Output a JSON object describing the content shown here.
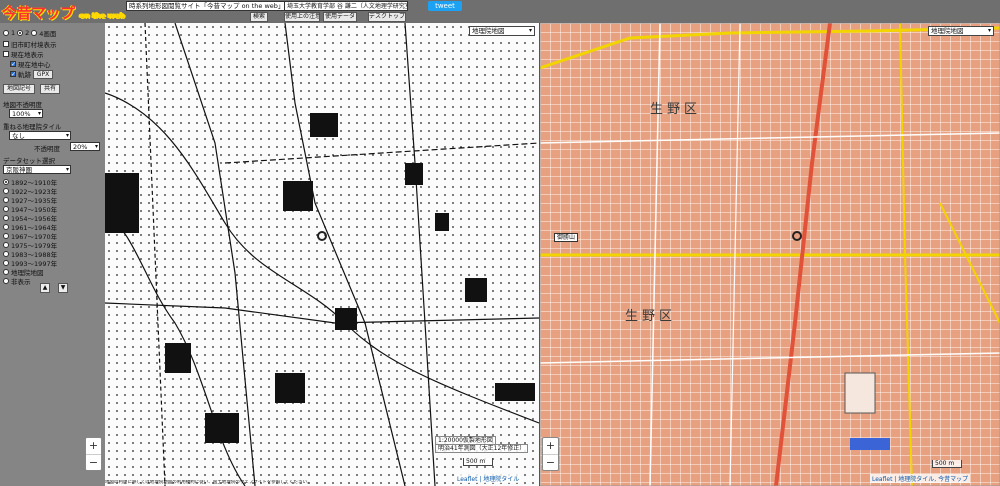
{
  "header": {
    "logo_main": "今昔マップ",
    "logo_sub": "on the web",
    "site_title": "時系列地形図閲覧サイト「今昔マップ on the web」",
    "author": "埼玉大学教育学部 谷 謙二（人文地理学研究室）",
    "buttons": {
      "help": "使用上の注意",
      "data": "使用データ",
      "desktop": "デスクトップ版",
      "how": "操作"
    },
    "tweet": "tweet",
    "search_label": "検索"
  },
  "sidebar": {
    "panes": [
      "1",
      "2",
      "4画面"
    ],
    "show_boundary": "旧市町村境表示",
    "show_location": "現在地表示",
    "current_center": "現在地中心",
    "track": "軌跡",
    "gpx": "GPX",
    "map_note": "地図記号",
    "share": "共有",
    "opacity_label": "地図不透明度",
    "opacity_value": "100%",
    "overlay_label": "重ねる地理院タイル",
    "overlay_value": "なし",
    "overlay_opacity_label": "不透明度",
    "overlay_opacity_value": "20%",
    "dataset_label": "データセット選択",
    "dataset_value": "京阪神圏",
    "periods": [
      "1892〜1910年",
      "1922〜1923年",
      "1927〜1935年",
      "1947〜1950年",
      "1954〜1956年",
      "1961〜1964年",
      "1967〜1970年",
      "1975〜1979年",
      "1983〜1988年",
      "1993〜1997年",
      "地理院地図",
      "非表示"
    ],
    "up": "▲",
    "down": "▼"
  },
  "left_map": {
    "selector": "地理院地図",
    "scale_label": "1:20000",
    "caption_1": "1:20000仮製地形図",
    "caption_2": "明治41年測図（大正12年修正）",
    "scale": "500 m",
    "attribution": "Leaflet | 地理院タイル"
  },
  "right_map": {
    "selector": "地理院地図",
    "ward_label_1": "生野区",
    "ward_label_2": "生野区",
    "station": "御勝山",
    "scale": "500 m",
    "attribution": "Leaflet | 地理院タイル, 今昔マップ"
  },
  "footer": "地図の利用に際しては地理院地図の利用規約に従い、国土地理院のウェブサイトを参照してください。",
  "colors": {
    "road_yellow": "#f2d400",
    "road_red": "#e0523a",
    "block_orange": "#e8a180",
    "logo_red": "#ff2f2f"
  }
}
